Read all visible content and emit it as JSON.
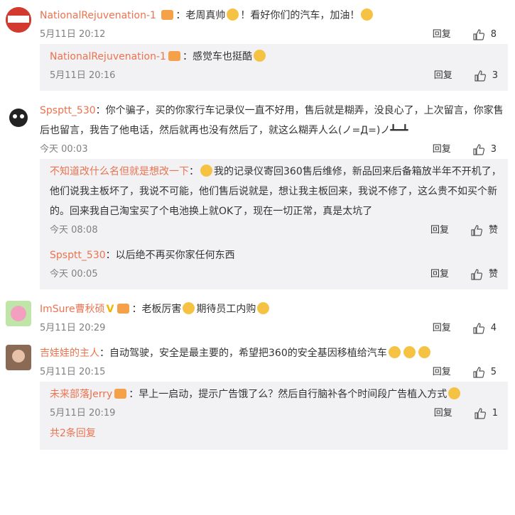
{
  "c1": {
    "name": "NationalRejuvenation-1",
    "pre": "老周真帅",
    "mid": "！看好你们的汽车，加油！",
    "time": "5月11日 20:12",
    "reply": "回复",
    "likes": "8"
  },
  "c1r1": {
    "name": "NationalRejuvenation-1",
    "text": "感觉车也挺酷",
    "time": "5月11日 20:16",
    "reply": "回复",
    "likes": "3"
  },
  "c2": {
    "name": "Spsptt_530",
    "text": "你个骗子，买的你家行车记录仪一直不好用，售后就是糊弄，没良心了，上次留言，你家售后也留言，我告了他电话，然后就再也没有然后了，就这么糊弄人么(ノ=Д=)ノ┻━┻",
    "time": "今天 00:03",
    "reply": "回复",
    "likes": "3"
  },
  "c2r1": {
    "name": "不知道改什么名但就是想改一下",
    "text": "我的记录仪寄回360售后维修，新品回来后备箱放半年不开机了，他们说我主板坏了，我说不可能，他们售后说就是，想让我主板回来，我说不修了，这么贵不如买个新的。回来我自己淘宝买了个电池换上就OK了，现在一切正常，真是太坑了",
    "time": "今天 08:08",
    "reply": "回复",
    "likes": "赞"
  },
  "c2r2": {
    "name": "Spsptt_530",
    "text": "以后绝不再买你家任何东西",
    "time": "今天 00:05",
    "reply": "回复",
    "likes": "赞"
  },
  "c3": {
    "name": "ImSure曹秋硕",
    "vip": "V",
    "pre": "老板厉害",
    "mid": "期待员工内购",
    "time": "5月11日 20:29",
    "reply": "回复",
    "likes": "4"
  },
  "c4": {
    "name": "吉娃娃的主人",
    "text": "自动驾驶，安全是最主要的，希望把360的安全基因移植给汽车",
    "time": "5月11日 20:15",
    "reply": "回复",
    "likes": "5"
  },
  "c4r1": {
    "name": "未来部落Jerry",
    "text": "早上一启动，提示广告饿了么？然后自行脑补各个时间段广告植入方式",
    "time": "5月11日 20:19",
    "reply": "回复",
    "likes": "1"
  },
  "more_replies": "共2条回复",
  "colors": {
    "name": "#eb7350",
    "meta": "#808080",
    "thread_bg": "#f2f2f5"
  }
}
